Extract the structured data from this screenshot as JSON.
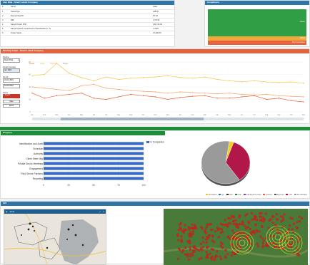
{
  "live_data": {
    "title": "Live Data - Smart Lubed Company",
    "headers": [
      "#",
      "Name",
      "Value"
    ],
    "rows": [
      [
        "1",
        "Stand Pipe",
        "238.00"
      ],
      [
        "2",
        "Flamed Gas Pit",
        "PT 10"
      ],
      [
        "3",
        "RBI",
        "1.37724"
      ],
      [
        "4",
        "Sanuk Project SPH",
        "132,718.00"
      ],
      [
        "5",
        "Sanuk Pipeline Centrehead of Standardize In. Tu",
        "1.4320"
      ],
      [
        "6",
        "Instant Value",
        "37,206.00"
      ]
    ]
  },
  "compliance": {
    "title": "Compliance",
    "bars": [
      {
        "label": "Green",
        "color": "#2f9e44"
      },
      {
        "label": "Amber",
        "color": "#f2a93b"
      },
      {
        "label": "Red / Incomplete",
        "color": "#e8623d"
      }
    ]
  },
  "monthly": {
    "title": "Monthly Graph - Smart Lubed Company",
    "series_legend": [
      "Actual",
      "Limit",
      "Planned",
      "Target"
    ],
    "controls": {
      "group_label": "Pipeline",
      "select_value": "Stand Pipe",
      "from_label": "Weekly Average",
      "from_value": "Apr 2020",
      "range_label": "Period",
      "start": "01-01-2019",
      "end": "01-04-2019",
      "mode_label": "Select",
      "mode_value": "1 Month",
      "btn_a": "Filter",
      "btn_b": "Reset"
    },
    "months": [
      "Jan",
      "Feb",
      "Mar",
      "Apr",
      "May",
      "Jun",
      "Jul",
      "Aug",
      "Sep",
      "Oct",
      "Nov",
      "Dec",
      "Jan",
      "Feb",
      "Mar",
      "Apr",
      "May",
      "Jun",
      "Jul",
      "Aug",
      "Sep",
      "Oct",
      "Nov"
    ]
  },
  "progress": {
    "title": "Progress",
    "legend": "% Completion",
    "xticks": [
      "0",
      "25",
      "50",
      "75",
      "100"
    ]
  },
  "map_left": {
    "title": "Areas"
  },
  "map_right_title": "GIS",
  "pie_legend": [
    "Not started",
    "QA",
    "Draft",
    "Final",
    "Submitted for review",
    "Queried",
    "Approved",
    "Late",
    "Re-submitted",
    "Lost"
  ],
  "chart_data": [
    {
      "type": "line",
      "title": "",
      "x": [
        "Jan",
        "Feb",
        "Mar",
        "Apr",
        "May",
        "Jun",
        "Jul",
        "Aug",
        "Sep",
        "Oct",
        "Nov",
        "Dec",
        "Jan",
        "Feb",
        "Mar",
        "Apr",
        "May",
        "Jun",
        "Jul",
        "Aug",
        "Sep",
        "Oct",
        "Nov"
      ],
      "ylim": [
        0,
        80
      ],
      "series": [
        {
          "name": "Actual",
          "color": "#e8623d",
          "values": [
            30,
            22,
            26,
            28,
            30,
            22,
            20,
            24,
            28,
            26,
            24,
            20,
            23,
            25,
            26,
            22,
            22,
            24,
            26,
            20,
            22,
            18,
            16
          ]
        },
        {
          "name": "Limit",
          "color": "#f6c64a",
          "values": [
            58,
            60,
            78,
            62,
            55,
            50,
            56,
            52,
            54,
            55,
            56,
            58,
            55,
            54,
            56,
            52,
            50,
            48,
            50,
            48,
            47,
            48,
            46
          ]
        },
        {
          "name": "Planned",
          "color": "#f4a36a",
          "values": [
            40,
            38,
            36,
            34,
            42,
            44,
            38,
            36,
            34,
            33,
            32,
            30,
            32,
            31,
            30,
            29,
            30,
            28,
            27,
            28,
            26,
            25,
            24
          ]
        }
      ]
    },
    {
      "type": "bar",
      "title": "",
      "legend": [
        "% Completion"
      ],
      "categories": [
        "Identification and Audit",
        "Schedule",
        "Authority",
        "Client Steer Mtg",
        "Private Sector Meetings",
        "Engagement",
        "Third Sector Partners",
        "Reporting"
      ],
      "values": [
        100,
        100,
        100,
        100,
        100,
        100,
        100,
        100
      ],
      "xlim": [
        0,
        100
      ]
    },
    {
      "type": "pie",
      "title": "",
      "values": [
        {
          "label": "Not started",
          "value": 3,
          "color": "#f0d020"
        },
        {
          "label": "Late",
          "value": 35,
          "color": "#b2174a"
        },
        {
          "label": "Complete",
          "value": 62,
          "color": "#9a9a9a"
        }
      ]
    }
  ]
}
